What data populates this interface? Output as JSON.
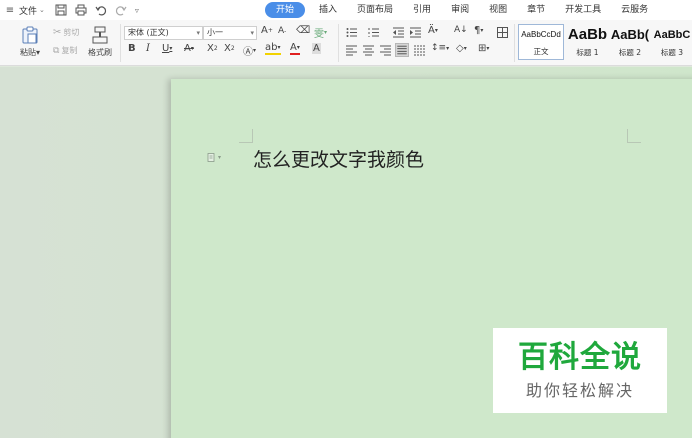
{
  "menubar": {
    "menu_icon": "hamburger-icon",
    "file_label": "文件",
    "tabs": [
      {
        "label": "开始",
        "active": true
      },
      {
        "label": "插入"
      },
      {
        "label": "页面布局"
      },
      {
        "label": "引用"
      },
      {
        "label": "审阅"
      },
      {
        "label": "视图"
      },
      {
        "label": "章节"
      },
      {
        "label": "开发工具"
      },
      {
        "label": "云服务"
      }
    ]
  },
  "toolbar": {
    "paste_label": "粘贴",
    "cut_label": "剪切",
    "copy_label": "复制",
    "format_painter_label": "格式刷",
    "font_name": "宋体 (正文)",
    "font_size": "小一",
    "styles": [
      {
        "sample": "AaBbCcDd",
        "name": "正文"
      },
      {
        "sample": "AaBb",
        "name": "标题 1"
      },
      {
        "sample": "AaBb(",
        "name": "标题 2"
      },
      {
        "sample": "AaBbC",
        "name": "标题 3"
      }
    ],
    "accent_color": "#4a8ee8"
  },
  "document": {
    "text": "怎么更改文字我颜色"
  },
  "watermark": {
    "title": "百科全说",
    "subtitle": "助你轻松解决"
  }
}
